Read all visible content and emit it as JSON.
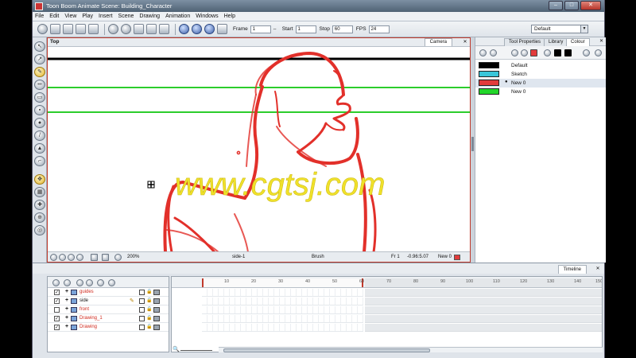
{
  "window": {
    "title": "Toon Boom Animate Scene: Building_Character",
    "min": "–",
    "max": "□",
    "close": "✕"
  },
  "menu": [
    "File",
    "Edit",
    "View",
    "Play",
    "Insert",
    "Scene",
    "Drawing",
    "Animation",
    "Windows",
    "Help"
  ],
  "toolbar": {
    "frame_label": "Frame",
    "frame_value": "1",
    "start_label": "Start",
    "start_value": "1",
    "stop_label": "Stop",
    "stop_value": "60",
    "fps_label": "FPS",
    "fps_value": "24",
    "workspace": "Default"
  },
  "view": {
    "title": "Top",
    "tab": "Camera",
    "close": "✕",
    "zoom": "200%",
    "layer": "side-1",
    "tool": "Brush",
    "frame": "Fr 1",
    "coords": "-0.96:5.07",
    "color": "New 0",
    "watermark": "www.cgtsj.com"
  },
  "palette": {
    "tabs": [
      "Tool Properties",
      "Library",
      "Colour"
    ],
    "active_tab": "Colour",
    "swatches": [
      {
        "name": "Default",
        "color": "#000000",
        "selected": false
      },
      {
        "name": "Sketch",
        "color": "#39c6d9",
        "selected": false
      },
      {
        "name": "New 0",
        "color": "#e23b3b",
        "selected": true
      },
      {
        "name": "New 0",
        "color": "#22d62a",
        "selected": false
      }
    ]
  },
  "timeline": {
    "tab": "Timeline",
    "close": "✕",
    "ticks": [
      "10",
      "20",
      "30",
      "40",
      "50",
      "60",
      "70",
      "80",
      "90",
      "100",
      "110",
      "120",
      "130",
      "140",
      "150"
    ],
    "layers": [
      {
        "name": "guides",
        "checked": true,
        "pen": false
      },
      {
        "name": "side",
        "checked": true,
        "pen": true
      },
      {
        "name": "front",
        "checked": false,
        "pen": false
      },
      {
        "name": "Drawing_1",
        "checked": true,
        "pen": false
      },
      {
        "name": "Drawing",
        "checked": true,
        "pen": false
      }
    ]
  },
  "colors": {
    "accent": "#c0392b",
    "guide_green": "#2ccd2c",
    "sketch_red": "#e2302a",
    "watermark_yellow": "#f0e12a"
  }
}
